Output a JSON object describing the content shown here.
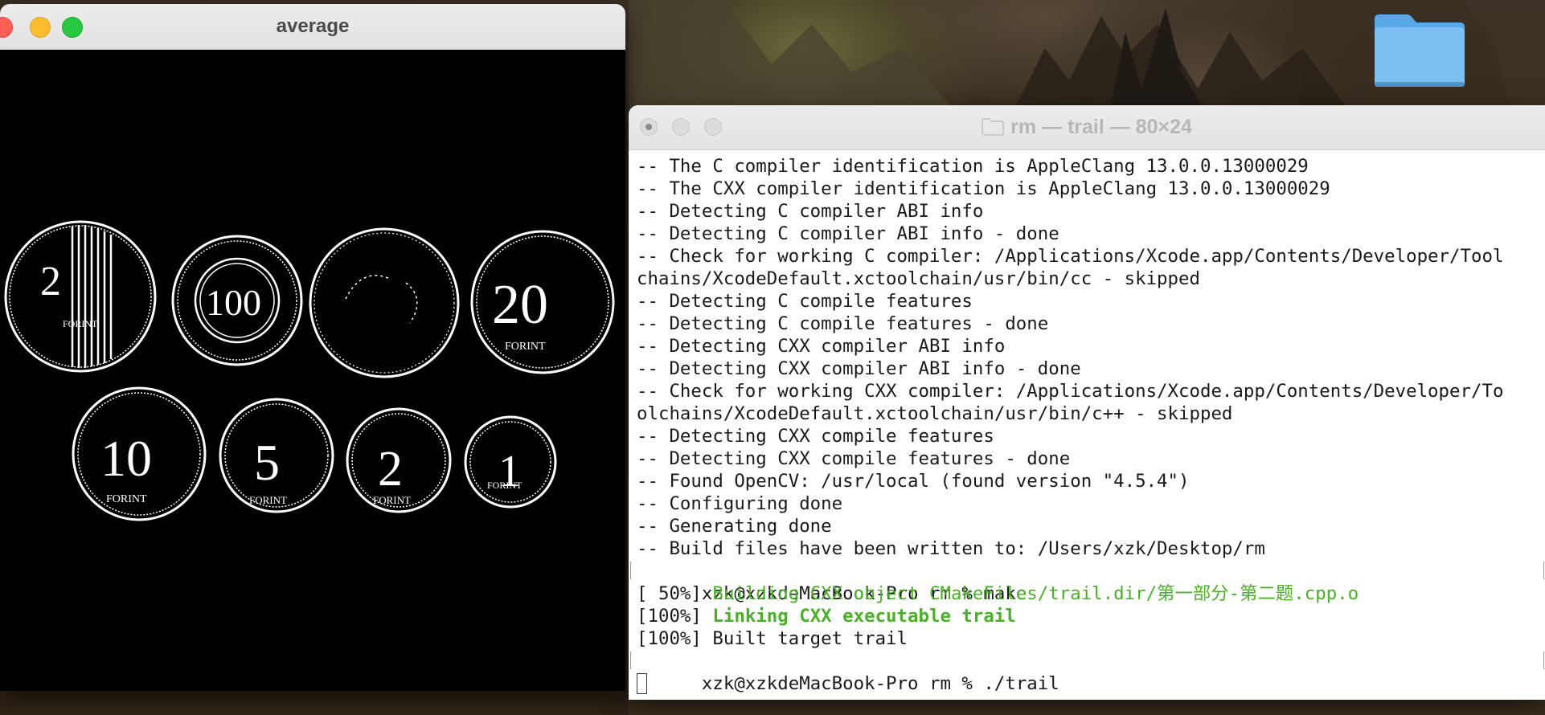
{
  "opencv_window": {
    "title": "average"
  },
  "terminal": {
    "title": "rm — trail — 80×24",
    "lines": [
      {
        "text": "-- The C compiler identification is AppleClang 13.0.0.13000029",
        "style": "normal"
      },
      {
        "text": "-- The CXX compiler identification is AppleClang 13.0.0.13000029",
        "style": "normal"
      },
      {
        "text": "-- Detecting C compiler ABI info",
        "style": "normal"
      },
      {
        "text": "-- Detecting C compiler ABI info - done",
        "style": "normal"
      },
      {
        "text": "-- Check for working C compiler: /Applications/Xcode.app/Contents/Developer/Tool",
        "style": "normal"
      },
      {
        "text": "chains/XcodeDefault.xctoolchain/usr/bin/cc - skipped",
        "style": "normal"
      },
      {
        "text": "-- Detecting C compile features",
        "style": "normal"
      },
      {
        "text": "-- Detecting C compile features - done",
        "style": "normal"
      },
      {
        "text": "-- Detecting CXX compiler ABI info",
        "style": "normal"
      },
      {
        "text": "-- Detecting CXX compiler ABI info - done",
        "style": "normal"
      },
      {
        "text": "-- Check for working CXX compiler: /Applications/Xcode.app/Contents/Developer/To",
        "style": "normal"
      },
      {
        "text": "olchains/XcodeDefault.xctoolchain/usr/bin/c++ - skipped",
        "style": "normal"
      },
      {
        "text": "-- Detecting CXX compile features",
        "style": "normal"
      },
      {
        "text": "-- Detecting CXX compile features - done",
        "style": "normal"
      },
      {
        "text": "-- Found OpenCV: /usr/local (found version \"4.5.4\")",
        "style": "normal"
      },
      {
        "text": "-- Configuring done",
        "style": "normal"
      },
      {
        "text": "-- Generating done",
        "style": "normal"
      },
      {
        "text": "-- Build files have been written to: /Users/xzk/Desktop/rm",
        "style": "normal"
      },
      {
        "text": "xzk@xzkdeMacBook-Pro rm % make",
        "style": "prompt"
      },
      {
        "prefix": "[ 50%] ",
        "text": "Building CXX object CMakeFiles/trail.dir/第一部分-第二题.cpp.o",
        "style": "green"
      },
      {
        "prefix": "[100%] ",
        "text": "Linking CXX executable trail",
        "style": "bold-green"
      },
      {
        "text": "[100%] Built target trail",
        "style": "normal"
      },
      {
        "text": "xzk@xzkdeMacBook-Pro rm % ./trail",
        "style": "prompt"
      }
    ]
  },
  "coins": [
    {
      "label_big": "2",
      "label_small": "FORINT"
    },
    {
      "label_big": "100",
      "label_small": ""
    },
    {
      "label_big": "",
      "label_small": ""
    },
    {
      "label_big": "20",
      "label_small": "FORINT"
    },
    {
      "label_big": "10",
      "label_small": "FORINT"
    },
    {
      "label_big": "5",
      "label_small": "FORINT"
    },
    {
      "label_big": "2",
      "label_small": "FORINT"
    },
    {
      "label_big": "1",
      "label_small": "FORINT"
    }
  ]
}
